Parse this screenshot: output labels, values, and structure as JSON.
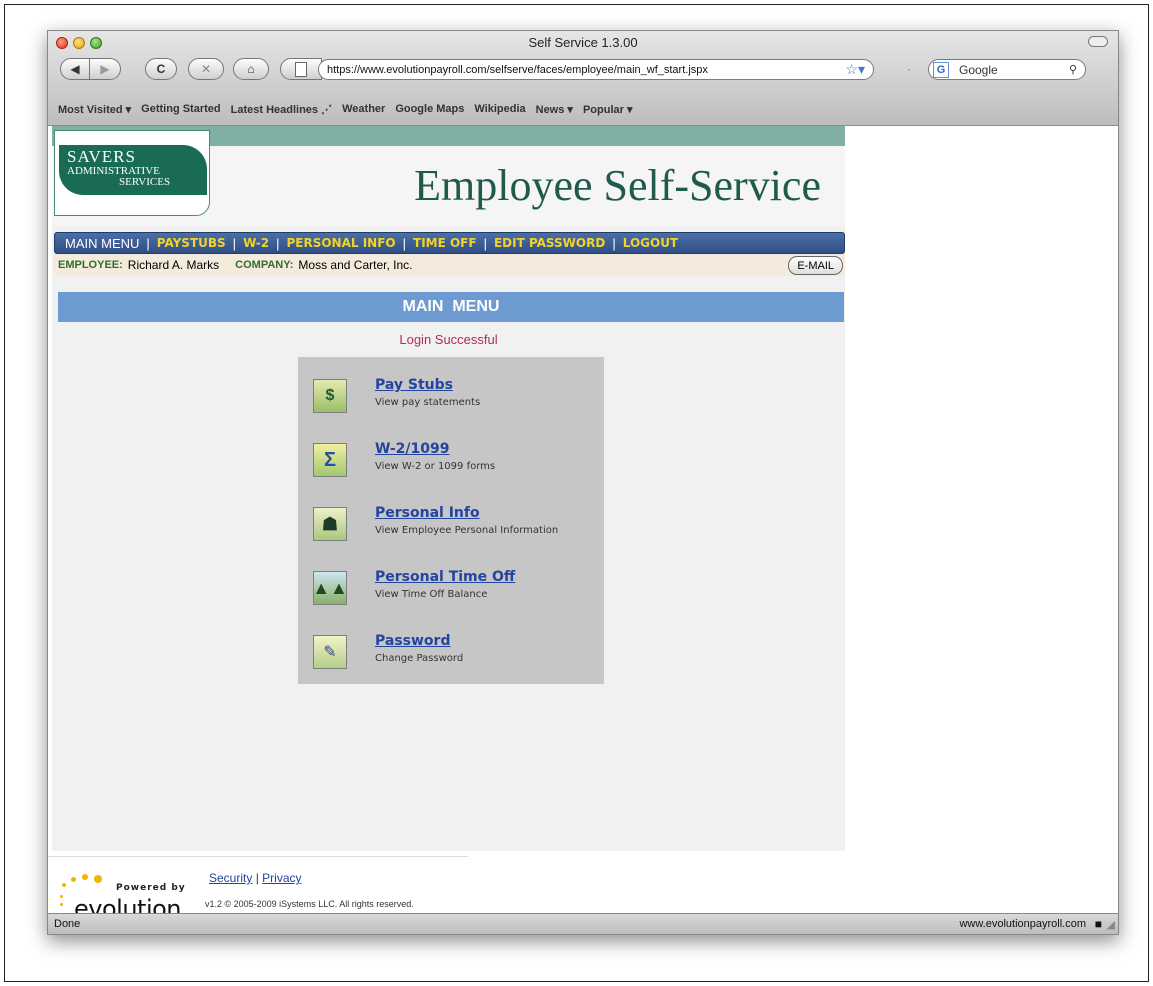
{
  "window": {
    "title": "Self Service 1.3.00"
  },
  "toolbar": {
    "back": "◀",
    "forward": "▶",
    "reload": "C",
    "stop": "✕",
    "home": "⌂",
    "url": "https://www.evolutionpayroll.com/selfserve/faces/employee/main_wf_start.jspx",
    "search_placeholder": "Google"
  },
  "bookmarks": [
    "Most Visited ▾",
    "Getting Started",
    "Latest Headlines ⋰",
    "Weather",
    "Google Maps",
    "Wikipedia",
    "News ▾",
    "Popular ▾"
  ],
  "banner": {
    "logo_line1": "SAVERS",
    "logo_line2": "ADMINISTRATIVE",
    "logo_line3": "SERVICES",
    "title": "Employee Self-Service"
  },
  "menu": {
    "items": [
      "MAIN MENU",
      "PAYSTUBS",
      "W-2",
      "PERSONAL INFO",
      "TIME OFF",
      "EDIT PASSWORD",
      "LOGOUT"
    ],
    "separator": "|"
  },
  "employee": {
    "employee_label": "EMPLOYEE:",
    "employee_name": "Richard A. Marks",
    "company_label": "COMPANY:",
    "company_name": "Moss and Carter, Inc.",
    "email_button": "E-MAIL"
  },
  "main": {
    "heading": "MAIN  MENU",
    "status": "Login Successful",
    "items": [
      {
        "title": "Pay Stubs",
        "desc": "View pay statements",
        "icon": "money-icon"
      },
      {
        "title": "W-2/1099",
        "desc": "View W-2 or 1099 forms",
        "icon": "sigma-icon"
      },
      {
        "title": "Personal Info",
        "desc": "View Employee Personal Information",
        "icon": "person-icon"
      },
      {
        "title": "Personal Time Off",
        "desc": "View Time Off Balance",
        "icon": "trees-icon"
      },
      {
        "title": "Password",
        "desc": "Change Password",
        "icon": "edit-icon"
      }
    ]
  },
  "footer": {
    "powered_by": "Powered by",
    "brand": "evolution",
    "link_security": "Security",
    "link_sep": "|",
    "link_privacy": "Privacy",
    "copyright": "v1.2 © 2005-2009 iSystems LLC. All rights reserved."
  },
  "status": {
    "left": "Done",
    "right": "www.evolutionpayroll.com"
  },
  "colors": {
    "menu_blue": "#2e4f86",
    "menu_yellow": "#f5d226",
    "heading_blue": "#6d9bd1",
    "link_blue": "#2344a0",
    "success_red": "#b03050"
  }
}
